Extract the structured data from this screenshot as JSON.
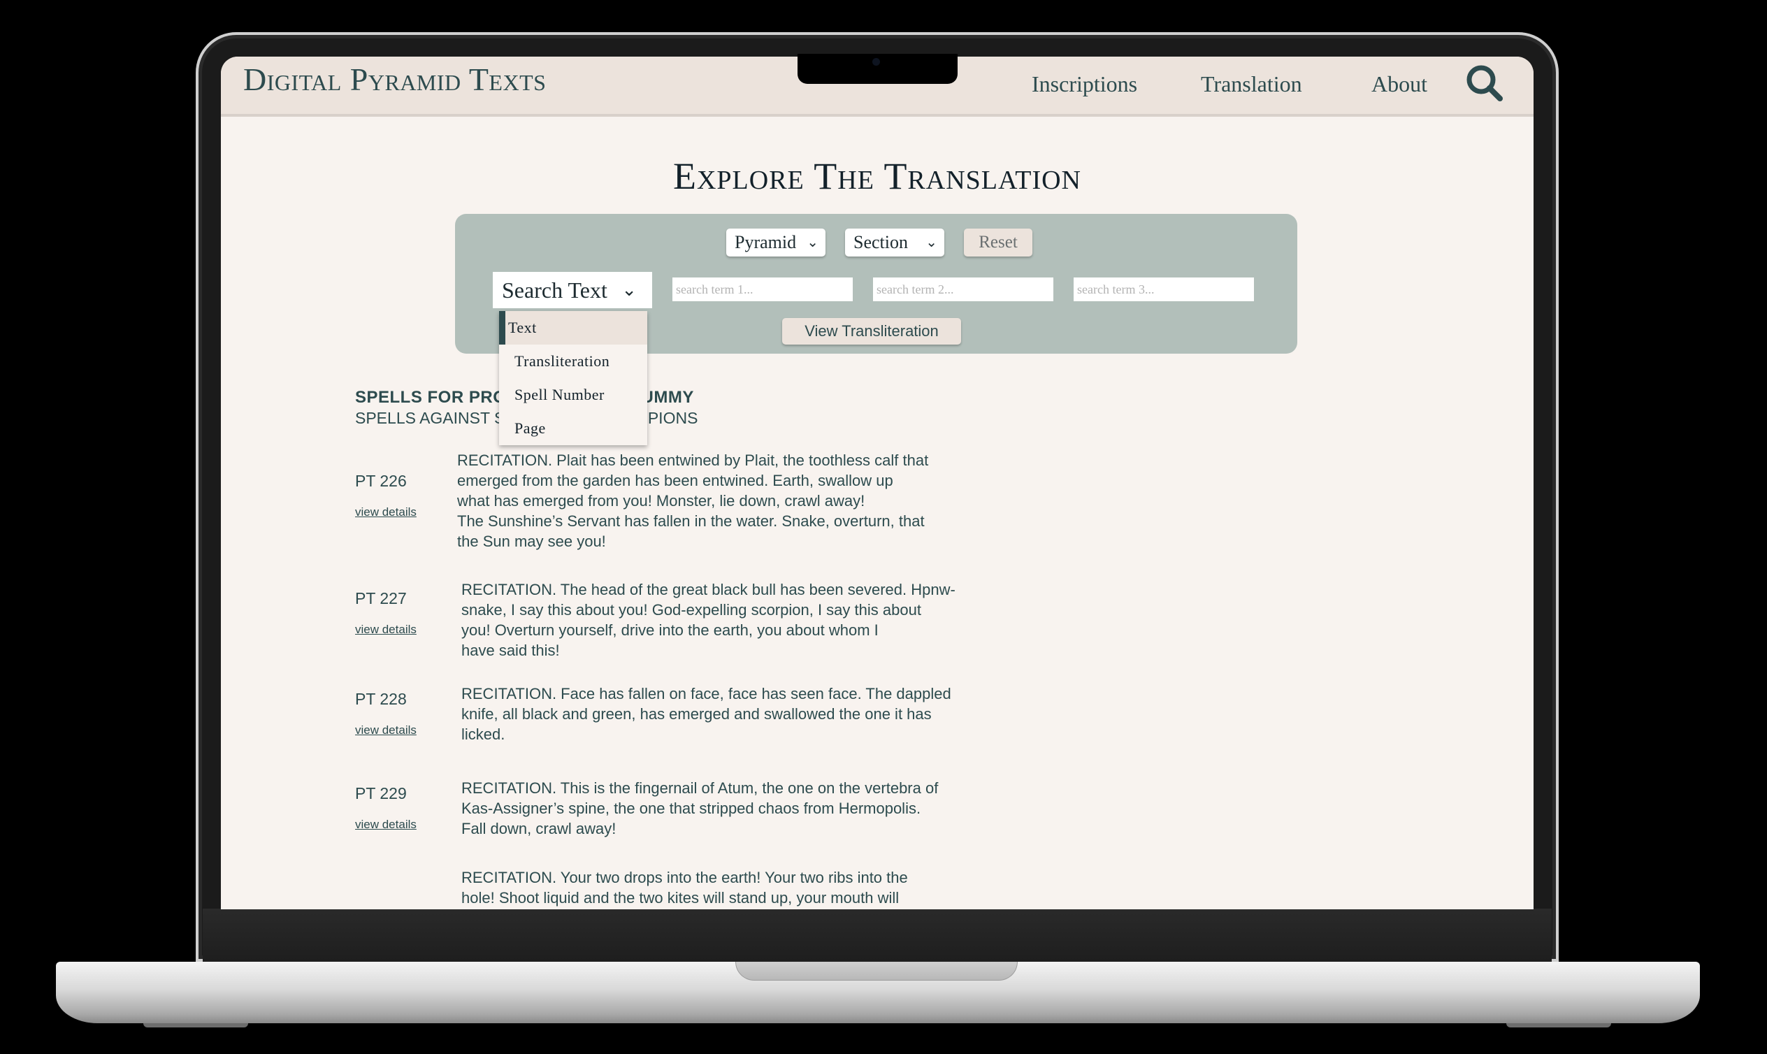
{
  "header": {
    "site_title": "Digital Pyramid Texts",
    "nav": {
      "inscriptions": "Inscriptions",
      "translation": "Translation",
      "about": "About"
    }
  },
  "page": {
    "title": "Explore The Translation"
  },
  "filters": {
    "pyramid_label": "Pyramid",
    "section_label": "Section",
    "reset_label": "Reset",
    "search_mode_label": "Search Text",
    "term1_placeholder": "search term 1...",
    "term2_placeholder": "search term 2...",
    "term3_placeholder": "search term 3...",
    "view_transliteration_label": "View Transliteration"
  },
  "dropdown": {
    "options": [
      "Text",
      "Transliteration",
      "Spell Number",
      "Page"
    ],
    "selected": "Text"
  },
  "content": {
    "group_title": "SPELLS FOR PROTECTING THE MUMMY",
    "group_subtitle": "SPELLS AGAINST SNAKES AND SCORPIONS",
    "view_details_label": "view details",
    "spells": [
      {
        "id": "PT 226",
        "text": " RECITATION. Plait has been entwined by Plait, the toothless calf that\nemerged from the garden has been entwined. Earth, swallow up\nwhat has emerged from you! Monster, lie down, crawl away!\nThe Sunshine’s Servant has fallen in the water. Snake, overturn, that\nthe Sun may see you!"
      },
      {
        "id": "PT 227",
        "text": "RECITATION. The head of the great black bull has been severed. Hpnw-\nsnake, I say this about you! God-expelling scorpion, I say this about\nyou! Overturn yourself, drive into the earth, you about whom I\nhave said this!"
      },
      {
        "id": "PT 228",
        "text": "RECITATION. Face has fallen on face, face has seen face. The dappled\nknife, all black and green, has emerged and swallowed the one it has\nlicked."
      },
      {
        "id": "PT 229",
        "text": "RECITATION. This is the fingernail of Atum, the one on the vertebra of\nKas-Assigner’s spine, the one that stripped chaos from Hermopolis.\nFall down, crawl away!"
      },
      {
        "id": "",
        "text": "RECITATION. Your two drops into the earth! Your two ribs into the\nhole! Shoot liquid and the two kites will stand up, your mouth will"
      }
    ]
  },
  "colors": {
    "accent": "#2d4b4e",
    "header_bg": "#ece3dc",
    "page_bg": "#f8f3ef",
    "panel_bg": "#b2bfba"
  }
}
